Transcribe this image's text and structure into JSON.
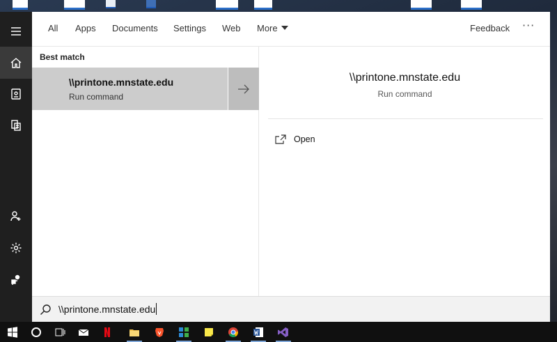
{
  "desktop": {
    "label": "desktop-wallpaper"
  },
  "rail": {
    "items": [
      {
        "icon": "hamburger-icon"
      },
      {
        "icon": "home-icon",
        "active": true
      },
      {
        "icon": "notebook-icon"
      },
      {
        "icon": "documents-icon"
      },
      {
        "icon": "user-add-icon"
      },
      {
        "icon": "gear-icon"
      },
      {
        "icon": "feedback-person-icon"
      }
    ]
  },
  "tabs": {
    "all": "All",
    "apps": "Apps",
    "documents": "Documents",
    "settings": "Settings",
    "web": "Web",
    "more": "More",
    "feedback": "Feedback",
    "overflow": "···"
  },
  "results": {
    "section_label": "Best match",
    "best_match": {
      "title": "\\\\printone.mnstate.edu",
      "subtitle": "Run command"
    }
  },
  "preview": {
    "title": "\\\\printone.mnstate.edu",
    "subtitle": "Run command",
    "actions": [
      {
        "label": "Open",
        "icon": "open-icon"
      }
    ]
  },
  "search": {
    "query": "\\\\printone.mnstate.edu",
    "icon": "search-icon"
  },
  "taskbar": {
    "items": [
      "windows-start-icon",
      "cortana-icon",
      "task-view-icon",
      "mail-icon",
      "netflix-icon",
      "file-explorer-icon",
      "brave-icon",
      "network-app-icon",
      "sticky-notes-icon",
      "chrome-icon",
      "word-icon",
      "visual-studio-icon"
    ]
  },
  "colors": {
    "accent": "#7fa7d9",
    "rail_bg": "#1f1f1f",
    "selected_result": "#cccccc"
  }
}
